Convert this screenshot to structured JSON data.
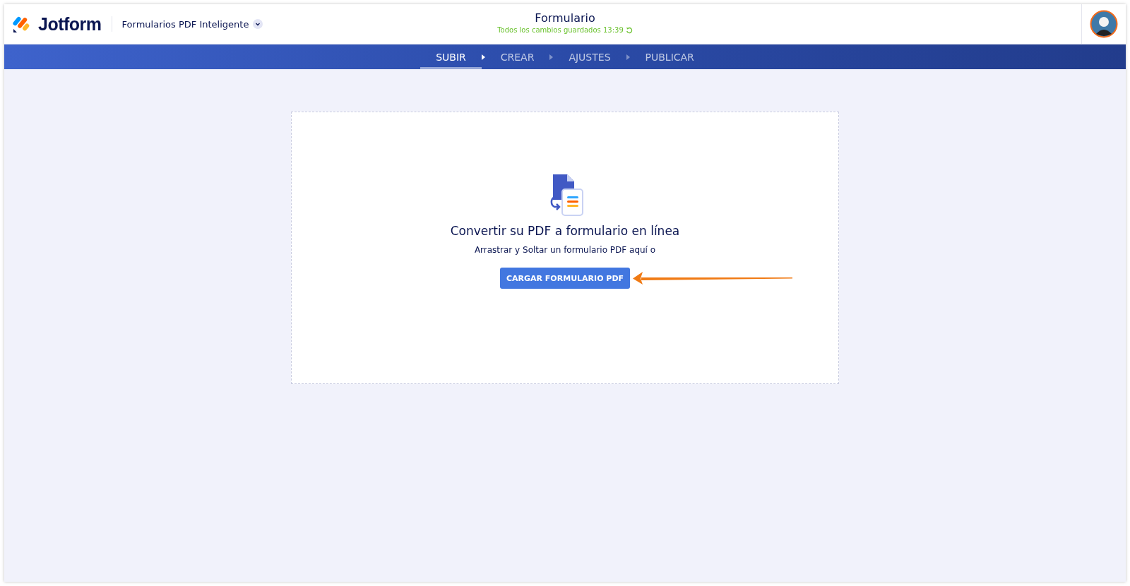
{
  "header": {
    "brand": "Jotform",
    "product": "Formularios PDF Inteligente",
    "title": "Formulario",
    "save_status": "Todos los cambios guardados 13:39"
  },
  "steps": [
    {
      "label": "SUBIR",
      "selected": true
    },
    {
      "label": "CREAR",
      "selected": false
    },
    {
      "label": "AJUSTES",
      "selected": false
    },
    {
      "label": "PUBLICAR",
      "selected": false
    }
  ],
  "upload": {
    "heading": "Convertir su PDF a formulario en línea",
    "hint": "Arrastrar y Soltar un formulario PDF aquí o",
    "button": "CARGAR FORMULARIO PDF"
  }
}
